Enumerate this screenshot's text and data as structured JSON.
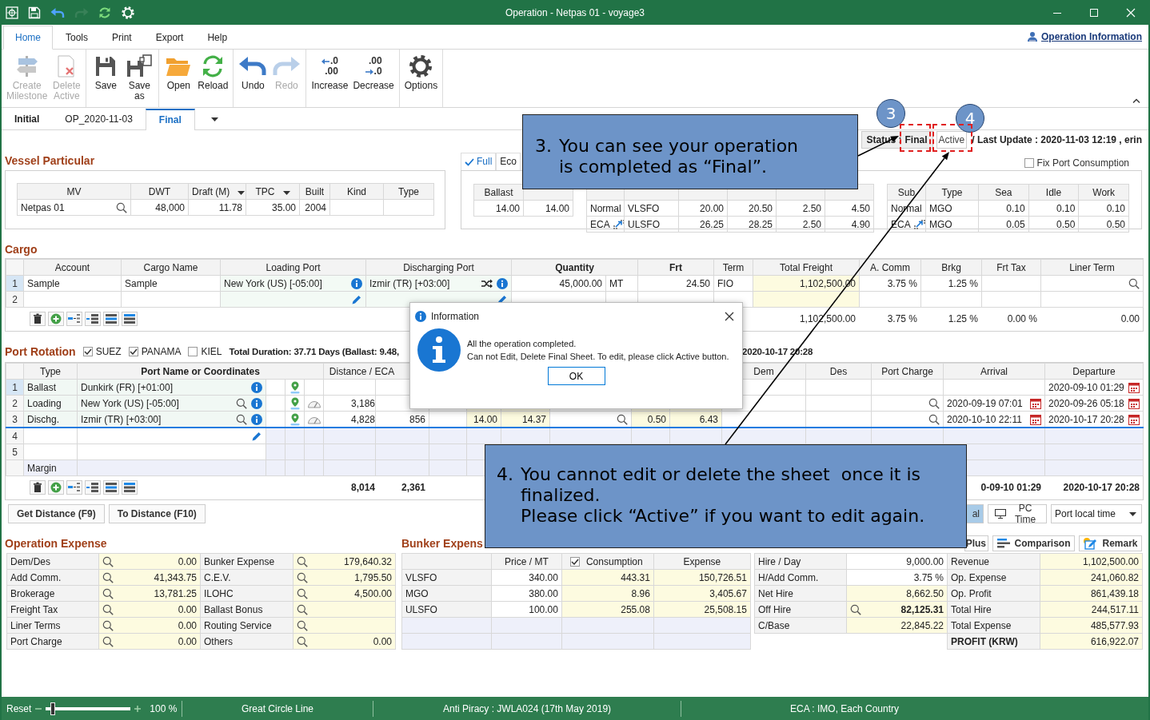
{
  "window": {
    "title": "Operation - Netpas 01 - voyage3"
  },
  "quick_access": [
    {
      "kind": "app",
      "disabled": false
    },
    {
      "kind": "save",
      "disabled": false
    },
    {
      "kind": "undo",
      "disabled": false
    },
    {
      "kind": "redo",
      "disabled": true
    },
    {
      "kind": "reload",
      "disabled": false
    },
    {
      "kind": "settings",
      "disabled": false
    }
  ],
  "menu_tabs": [
    {
      "label": "Home",
      "selected": true
    },
    {
      "label": "Tools",
      "selected": false
    },
    {
      "label": "Print",
      "selected": false
    },
    {
      "label": "Export",
      "selected": false
    },
    {
      "label": "Help",
      "selected": false
    }
  ],
  "info_link": {
    "label": "Operation Information"
  },
  "ribbon": {
    "groups": [
      [
        {
          "kind": "milestone",
          "label": [
            "Create",
            "Milestone"
          ],
          "disabled": true
        },
        {
          "kind": "delete",
          "label": [
            "Delete",
            "Active"
          ],
          "disabled": true
        }
      ],
      [
        {
          "kind": "save",
          "label": [
            "Save"
          ],
          "disabled": false
        },
        {
          "kind": "save_as",
          "label": [
            "Save",
            "as"
          ],
          "disabled": false
        }
      ],
      [
        {
          "kind": "open",
          "label": [
            "Open"
          ],
          "disabled": false
        },
        {
          "kind": "reload",
          "label": [
            "Reload"
          ],
          "disabled": false
        }
      ],
      [
        {
          "kind": "undo",
          "label": [
            "Undo"
          ],
          "disabled": false
        },
        {
          "kind": "redo",
          "label": [
            "Redo"
          ],
          "disabled": true
        }
      ],
      [
        {
          "kind": "increase",
          "label": [
            "Increase"
          ],
          "glyph": [
            ".0",
            ".00"
          ],
          "disabled": false
        },
        {
          "kind": "decrease",
          "label": [
            "Decrease"
          ],
          "glyph": [
            ".00",
            ".0"
          ],
          "disabled": false
        }
      ],
      [
        {
          "kind": "options",
          "label": [
            "Options"
          ],
          "disabled": false
        }
      ]
    ]
  },
  "sheet_tabs": [
    {
      "label": "Initial",
      "kind": "initial",
      "selected": false
    },
    {
      "label": "OP_2020-11-03",
      "kind": "milestone",
      "selected": false
    },
    {
      "label": "Final",
      "kind": "final",
      "selected": true
    }
  ],
  "status": {
    "label": "Status :",
    "value": "Final",
    "active_button": "Active",
    "last_update": "/ Last Update : 2020-11-03 12:19 , erin"
  },
  "vessel_particular": {
    "title": "Vessel Particular",
    "columns": [
      {
        "label": "MV",
        "dropdown": false
      },
      {
        "label": "DWT",
        "dropdown": false
      },
      {
        "label": "Draft (M)",
        "dropdown": true
      },
      {
        "label": "TPC",
        "dropdown": true
      },
      {
        "label": "Built",
        "dropdown": false
      },
      {
        "label": "Kind",
        "dropdown": false
      },
      {
        "label": "Type",
        "dropdown": false
      }
    ],
    "row": {
      "mv": "Netpas 01",
      "dwt": "48,000",
      "draft": "11.78",
      "tpc": "35.00",
      "built": "2004"
    }
  },
  "consumption": {
    "tabs": [
      {
        "label": "Full",
        "selected": true
      },
      {
        "label": "Eco",
        "selected": false
      }
    ],
    "speed": {
      "columns": [
        "Ballast"
      ],
      "row": [
        "14.00",
        "14.00"
      ]
    },
    "sea_rows": [
      {
        "kind": "normal",
        "cells": [
          "Normal",
          "VLSFO",
          "20.00",
          "20.50",
          "2.50",
          "4.50"
        ]
      },
      {
        "kind": "eca",
        "cells": [
          "ECA",
          "ULSFO",
          "26.25",
          "28.25",
          "2.50",
          "4.90"
        ]
      }
    ],
    "fix_port_consumption": {
      "label": "Fix Port Consumption",
      "checked": false
    },
    "port": {
      "columns": [
        "Sub",
        "Type",
        "Sea",
        "Idle",
        "Work"
      ],
      "rows": [
        {
          "kind": "normal",
          "cells": [
            "Normal",
            "MGO",
            "0.10",
            "0.10",
            "0.10"
          ]
        },
        {
          "kind": "eca",
          "cells": [
            "ECA",
            "MGO",
            "0.05",
            "0.50",
            "0.50"
          ]
        }
      ]
    }
  },
  "cargo": {
    "title": "Cargo",
    "columns": [
      {
        "label": "Account",
        "bold": false
      },
      {
        "label": "Cargo Name",
        "bold": false
      },
      {
        "label": "Loading Port",
        "bold": false
      },
      {
        "label": "Discharging Port",
        "bold": false
      },
      {
        "label": "Quantity",
        "bold": true
      },
      {
        "label": "Frt",
        "bold": true
      },
      {
        "label": "Term",
        "bold": false
      },
      {
        "label": "Total Freight",
        "bold": false
      },
      {
        "label": "A. Comm",
        "bold": false
      },
      {
        "label": "Brkg",
        "bold": false
      },
      {
        "label": "Frt Tax",
        "bold": false
      },
      {
        "label": "Liner Term",
        "bold": false
      }
    ],
    "rows": [
      {
        "number": "1",
        "selected": true,
        "editing": false,
        "account": "Sample",
        "cargo_name": "Sample",
        "loading_port": "New York (US) [-05:00]",
        "discharging_port": "Izmir (TR) [+03:00]",
        "quantity": "45,000.00",
        "unit": "MT",
        "frt": "24.50",
        "term": "FIO",
        "total_freight": "1,102,500.00",
        "a_comm": "3.75 %",
        "brkg": "1.25 %"
      },
      {
        "number": "2",
        "selected": false,
        "editing": true
      }
    ],
    "totals": {
      "total_freight": "1,102,500.00",
      "a_comm": "3.75 %",
      "brkg": "1.25 %",
      "frt_tax": "0.00 %",
      "liner_term": "0.00"
    }
  },
  "port_rotation": {
    "title": "Port Rotation",
    "routes": [
      {
        "label": "SUEZ",
        "checked": true
      },
      {
        "label": "PANAMA",
        "checked": true
      },
      {
        "label": "KIEL",
        "checked": false
      }
    ],
    "summary": "Total Duration: 37.71 Days (Ballast: 9.48,",
    "summary_end": "2020-10-17 20:28",
    "columns": [
      {
        "label": "Type",
        "bold": false
      },
      {
        "label": "Port Name or Coordinates",
        "bold": true
      },
      {
        "label": "Distance / ECA",
        "bold": false
      },
      {
        "label": "Dem",
        "bold": false
      },
      {
        "label": "Des",
        "bold": false
      },
      {
        "label": "Port Charge",
        "bold": false
      },
      {
        "label": "Arrival",
        "bold": false
      },
      {
        "label": "Departure",
        "bold": false
      }
    ],
    "rows": [
      {
        "number": "1",
        "selected": true,
        "focused": false,
        "editing": false,
        "lookup": false,
        "type": "Ballast",
        "port": "Dunkirk (FR) [+01:00]",
        "departure": "2020-09-10 01:29"
      },
      {
        "number": "2",
        "selected": false,
        "focused": false,
        "editing": false,
        "lookup": true,
        "type": "Loading",
        "port": "New York (US) [-05:00]",
        "distance": "3,186",
        "arrival": "2020-09-19 07:01",
        "departure": "2020-09-26 05:18"
      },
      {
        "number": "3",
        "selected": false,
        "focused": true,
        "editing": false,
        "lookup": true,
        "type": "Dischg.",
        "port": "Izmir (TR) [+03:00]",
        "distance": "4,828",
        "eca": "856",
        "column_10": "14.00",
        "column_11": "14.37",
        "column_13": "0.50",
        "column_14": "6.43",
        "arrival": "2020-10-10 22:11",
        "departure": "2020-10-17 20:28"
      },
      {
        "number": "4",
        "selected": false,
        "focused": false,
        "editing": true,
        "lookup": false
      },
      {
        "number": "5",
        "selected": false,
        "focused": false,
        "editing": false,
        "lookup": false
      },
      {
        "selected": false,
        "focused": false,
        "editing": false,
        "lookup": false,
        "type": "Margin"
      }
    ],
    "totals": {
      "distance": "8,014",
      "eca": "2,361",
      "arrival": "0-09-10 01:29",
      "departure": "2020-10-17 20:28"
    }
  },
  "distance_buttons": [
    "Get Distance (F9)",
    "To Distance (F10)"
  ],
  "time_modes": [
    {
      "label": "al",
      "kind": "local",
      "selected": true
    },
    {
      "label": "PC Time",
      "kind": "pc",
      "selected": false
    }
  ],
  "time_zone": {
    "value": "Port local time"
  },
  "operation_expense": {
    "title": "Operation Expense",
    "rows": [
      [
        {
          "label": "Dem/Des",
          "value": "0.00"
        },
        {
          "label": "Bunker Expense",
          "value": "179,640.32"
        }
      ],
      [
        {
          "label": "Add Comm.",
          "value": "41,343.75"
        },
        {
          "label": "C.E.V.",
          "value": "1,795.50"
        }
      ],
      [
        {
          "label": "Brokerage",
          "value": "13,781.25"
        },
        {
          "label": "ILOHC",
          "value": "4,500.00"
        }
      ],
      [
        {
          "label": "Freight Tax",
          "value": "0.00"
        },
        {
          "label": "Ballast Bonus"
        }
      ],
      [
        {
          "label": "Liner Terms",
          "value": "0.00"
        },
        {
          "label": "Routing Service"
        }
      ],
      [
        {
          "label": "Port Charge",
          "value": "0.00"
        },
        {
          "label": "Others",
          "value": "0.00"
        }
      ]
    ]
  },
  "bunker_expense": {
    "title": "Bunker Expens",
    "columns": [
      {
        "label": "Price / MT"
      },
      {
        "label": "Consumption",
        "checked": true
      },
      {
        "label": "Expense"
      }
    ],
    "rows": [
      {
        "fuel": "VLSFO",
        "price": "340.00",
        "consumption": "443.31",
        "expense": "150,726.51"
      },
      {
        "fuel": "MGO",
        "price": "380.00",
        "consumption": "8.96",
        "expense": "3,405.67"
      },
      {
        "fuel": "ULSFO",
        "price": "100.00",
        "consumption": "255.08",
        "expense": "25,508.15"
      }
    ]
  },
  "actions": [
    {
      "label": "Plus",
      "kind": "plus"
    },
    {
      "label": "Comparison",
      "kind": "comparison"
    },
    {
      "label": "Remark",
      "kind": "remark"
    }
  ],
  "hire": {
    "left": [
      {
        "label": "Hire / Day",
        "value": "9,000.00",
        "editable": true,
        "search": false
      },
      {
        "label": "H/Add Comm.",
        "value": "3.75 %",
        "editable": true,
        "search": false
      },
      {
        "label": "Net Hire",
        "value": "8,662.50",
        "editable": false,
        "search": false
      },
      {
        "label": "Off Hire",
        "value": "82,125.31",
        "editable": false,
        "search": true
      },
      {
        "label": "C/Base",
        "value": "22,845.22",
        "editable": false,
        "search": false
      }
    ],
    "right": [
      {
        "label": "Revenue",
        "value": "1,102,500.00",
        "bold": false
      },
      {
        "label": "Op. Expense",
        "value": "241,060.82",
        "bold": false
      },
      {
        "label": "Op. Profit",
        "value": "861,439.18",
        "bold": false
      },
      {
        "label": "Total Hire",
        "value": "244,517.11",
        "bold": false
      },
      {
        "label": "Total Expense",
        "value": "485,577.93",
        "bold": false
      },
      {
        "label": "PROFIT (KRW)",
        "value": "616,922.07",
        "bold": true
      }
    ]
  },
  "status_bar": {
    "reset": "Reset",
    "zoom": {
      "level": 0.05
    },
    "zoom_label": "100 %",
    "sections": [
      "Great Circle Line",
      "Anti Piracy : JWLA024 (17th May 2019)",
      "ECA : IMO, Each Country"
    ]
  },
  "dialog": {
    "title": "Information",
    "message": [
      "All the operation completed.",
      "Can not Edit, Delete Final Sheet. To edit, please click Active button."
    ],
    "button": "OK"
  },
  "callouts": [
    {
      "number": "3.",
      "lines": [
        "You can see your operation",
        "is completed as “Final”."
      ]
    },
    {
      "number": "4.",
      "lines": [
        "You cannot edit or delete the sheet  once it is",
        "finalized.",
        "Please click “Active” if you want to edit again."
      ]
    }
  ],
  "markers": [
    {
      "label": "3"
    },
    {
      "label": "4"
    }
  ]
}
